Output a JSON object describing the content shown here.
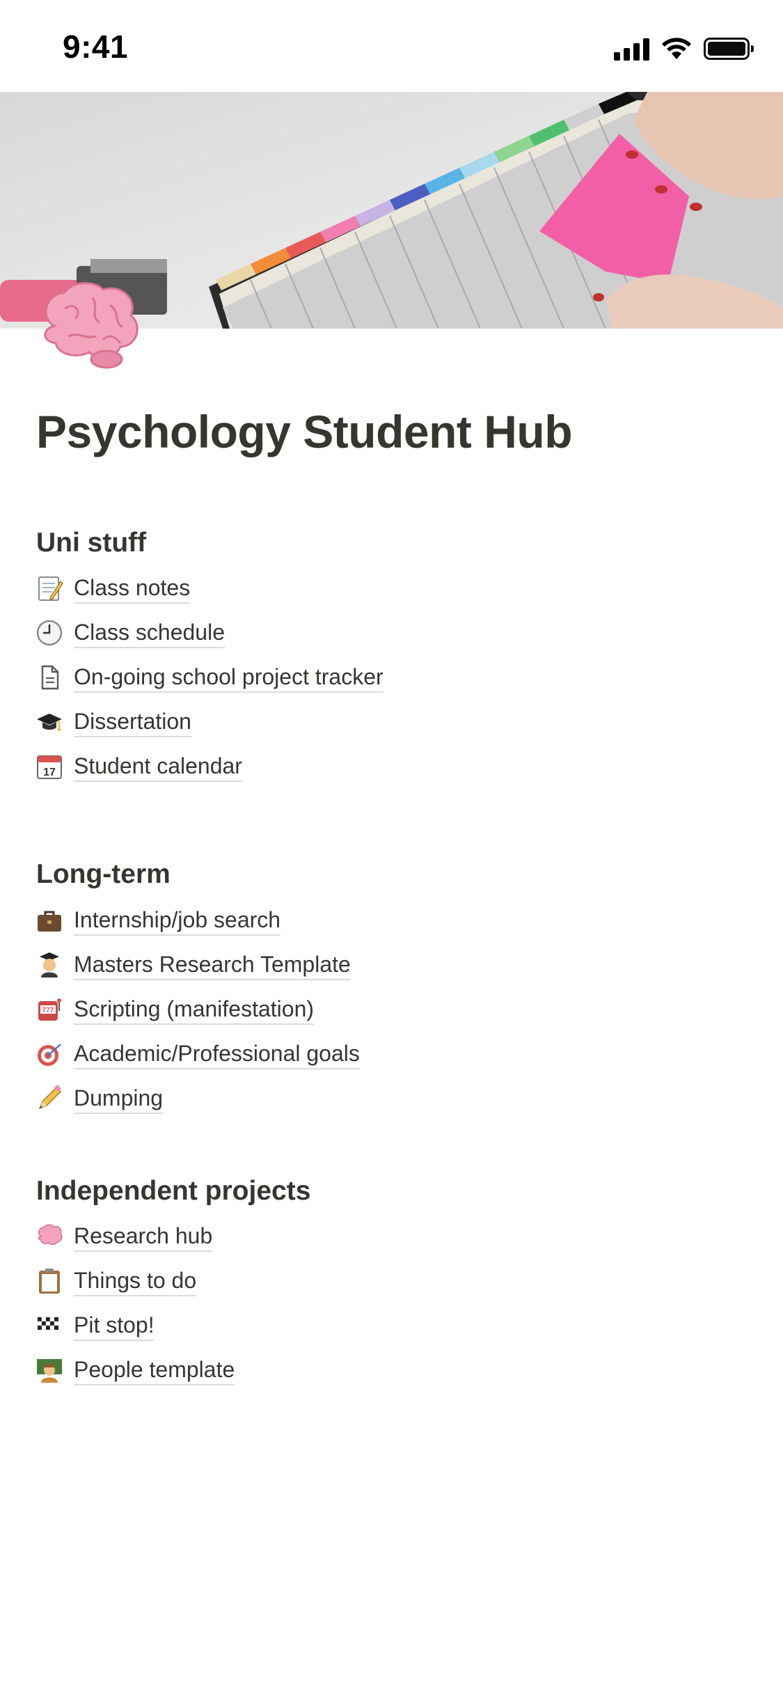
{
  "status_bar": {
    "time": "9:41"
  },
  "page": {
    "title": "Psychology Student Hub",
    "icon": "brain-icon"
  },
  "sections": [
    {
      "heading": "Uni stuff",
      "items": [
        {
          "icon": "memo-icon",
          "label": "Class notes"
        },
        {
          "icon": "clock-icon",
          "label": "Class schedule"
        },
        {
          "icon": "document-icon",
          "label": "On-going school project tracker"
        },
        {
          "icon": "graduation-cap-icon",
          "label": "Dissertation"
        },
        {
          "icon": "calendar-icon",
          "label": "Student calendar"
        }
      ]
    },
    {
      "heading": "Long-term",
      "items": [
        {
          "icon": "briefcase-icon",
          "label": "Internship/job search"
        },
        {
          "icon": "student-icon",
          "label": "Masters Research Template"
        },
        {
          "icon": "slot-machine-icon",
          "label": "Scripting (manifestation)"
        },
        {
          "icon": "target-icon",
          "label": "Academic/Professional goals"
        },
        {
          "icon": "pencil-icon",
          "label": "Dumping"
        }
      ]
    },
    {
      "heading": "Independent projects",
      "items": [
        {
          "icon": "brain-icon",
          "label": "Research hub"
        },
        {
          "icon": "clipboard-icon",
          "label": "Things to do"
        },
        {
          "icon": "checkered-flag-icon",
          "label": "Pit stop!"
        },
        {
          "icon": "teacher-icon",
          "label": "People template"
        }
      ]
    }
  ]
}
